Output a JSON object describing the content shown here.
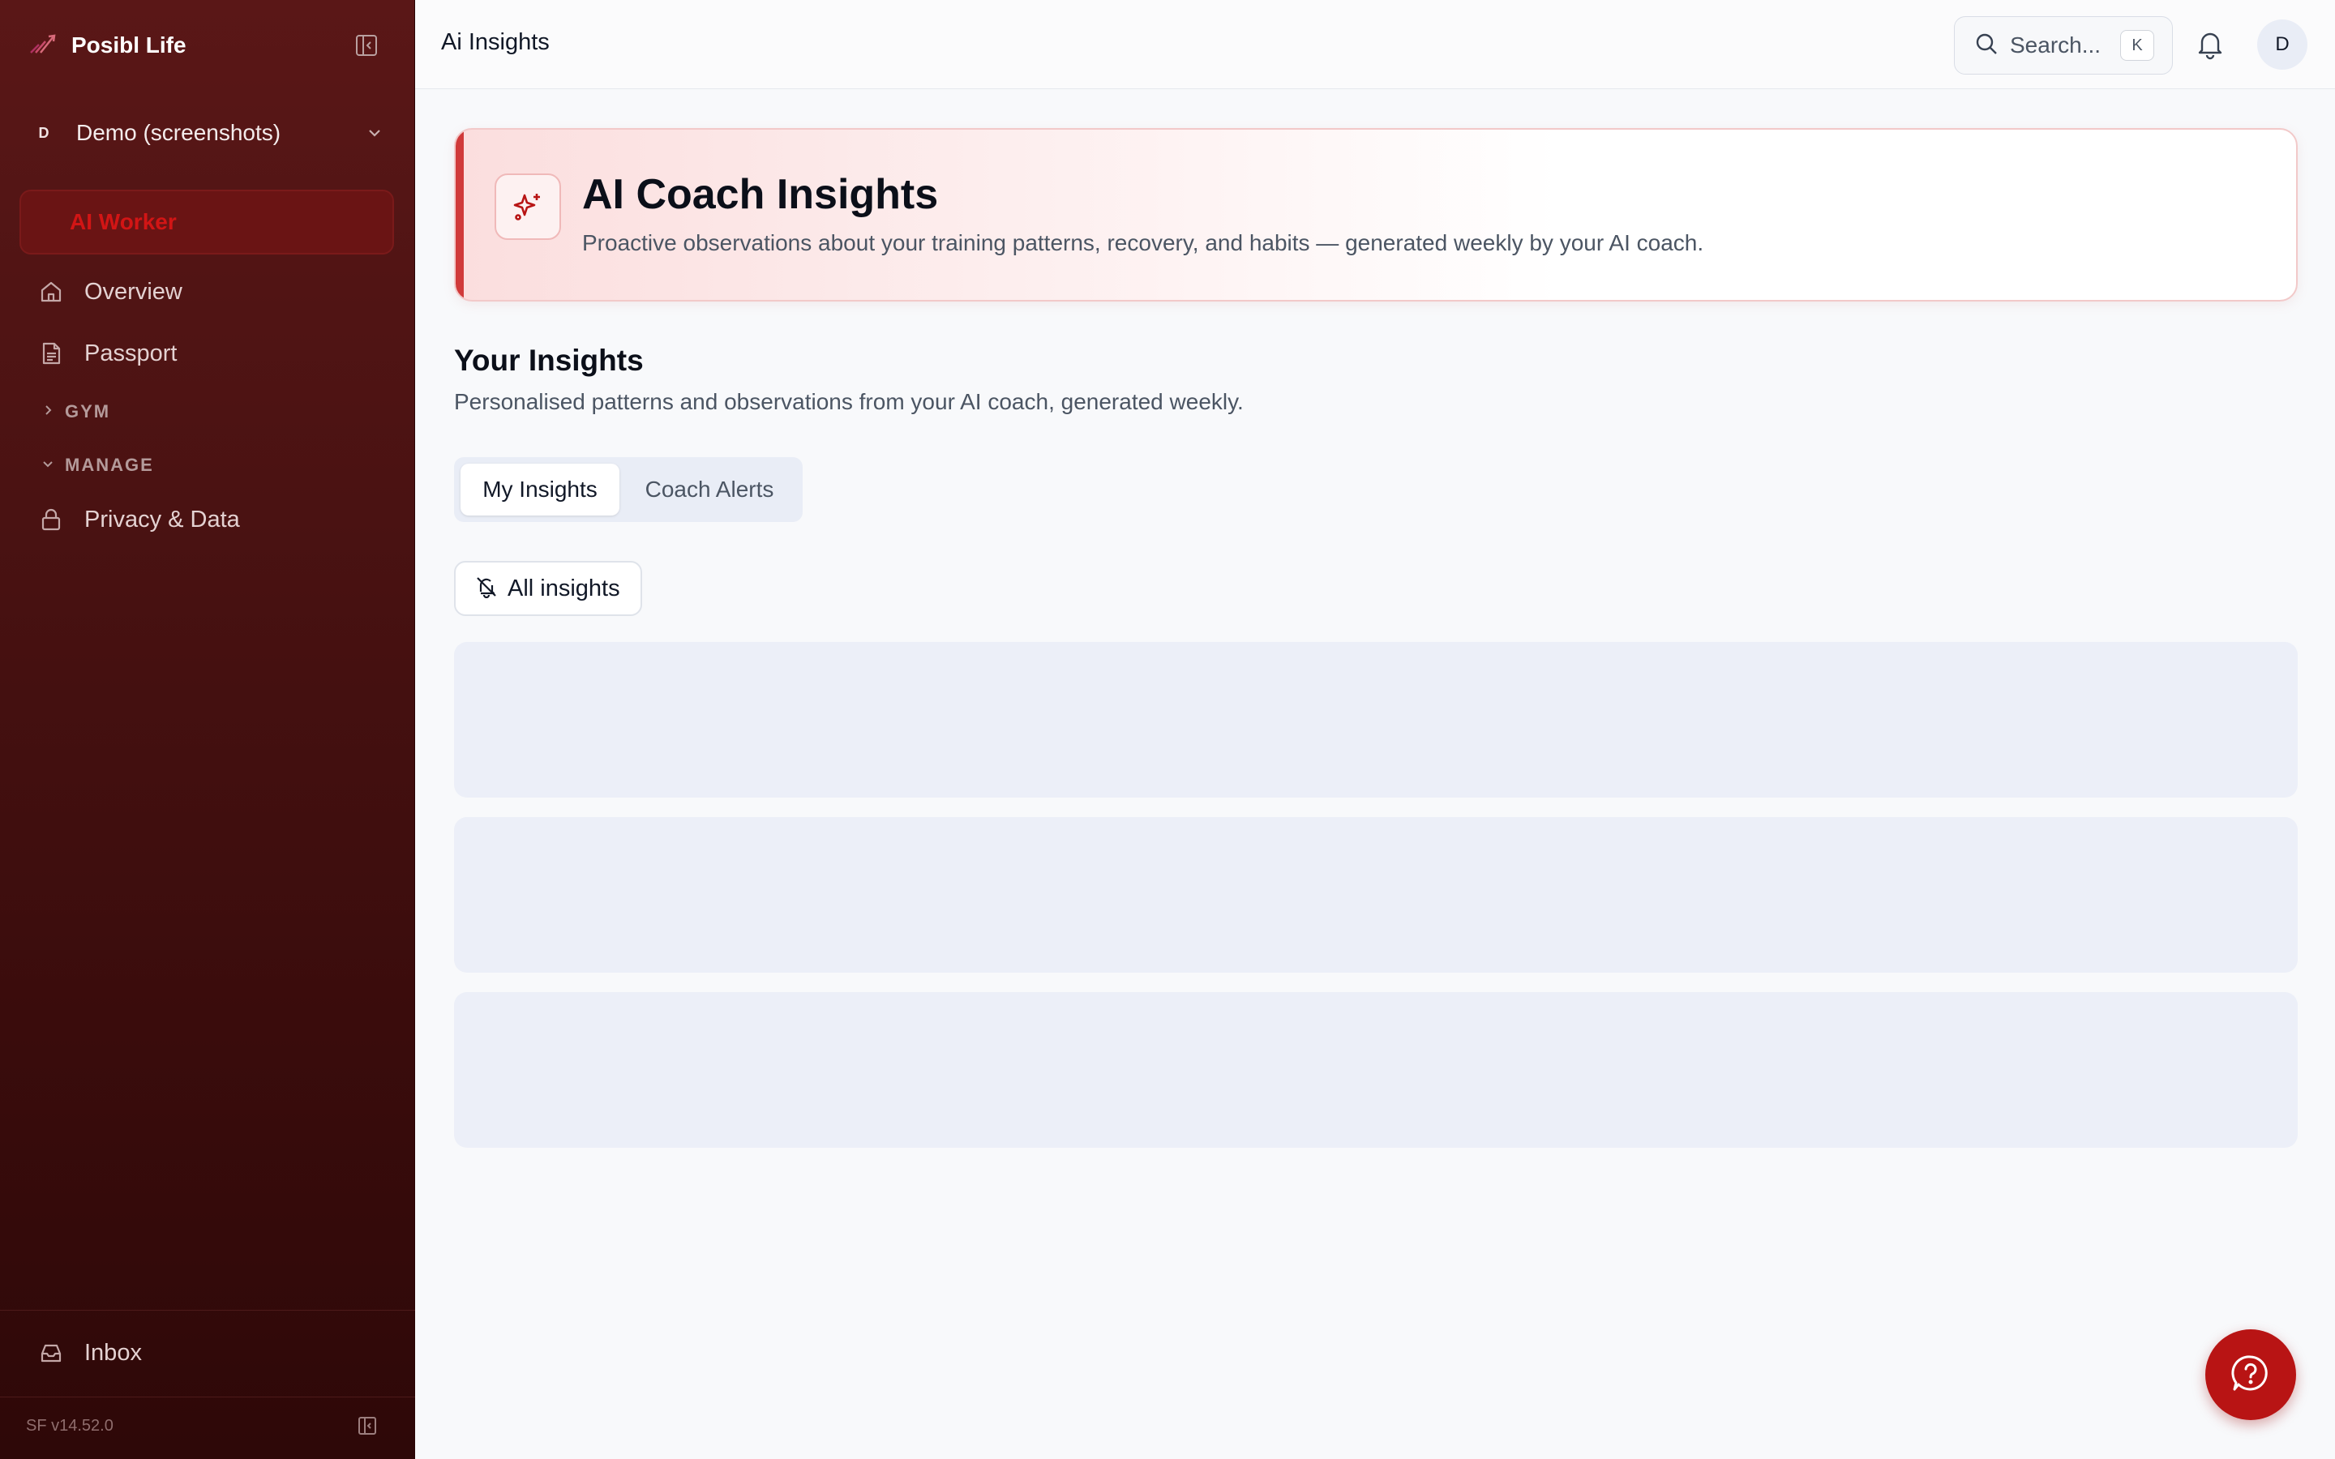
{
  "sidebar": {
    "brand": "Posibl Life",
    "workspace": {
      "initial": "D",
      "name": "Demo (screenshots)"
    },
    "active_item": "AI Worker",
    "items": [
      {
        "label": "Overview",
        "icon": "home-icon"
      },
      {
        "label": "Passport",
        "icon": "document-icon"
      }
    ],
    "sections": [
      {
        "label": "GYM",
        "expanded": false
      },
      {
        "label": "MANAGE",
        "expanded": true
      }
    ],
    "manage_items": [
      {
        "label": "Privacy & Data",
        "icon": "lock-icon"
      }
    ],
    "footer_item": {
      "label": "Inbox",
      "icon": "inbox-icon"
    },
    "version": "SF v14.52.0"
  },
  "topbar": {
    "title": "Ai Insights",
    "search_placeholder": "Search...",
    "search_shortcut": "K",
    "user_initial": "D"
  },
  "hero": {
    "title": "AI Coach Insights",
    "subtitle": "Proactive observations about your training patterns, recovery, and habits — generated weekly by your AI coach."
  },
  "insights": {
    "title": "Your Insights",
    "subtitle": "Personalised patterns and observations from your AI coach, generated weekly.",
    "tabs": [
      {
        "label": "My Insights",
        "active": true
      },
      {
        "label": "Coach Alerts",
        "active": false
      }
    ],
    "filter_label": "All insights",
    "skeleton_rows": 3
  },
  "colors": {
    "accent": "#b81414",
    "sidebar_bg": "#4a1212",
    "active_text": "#d21515",
    "skeleton": "#eceff8"
  }
}
